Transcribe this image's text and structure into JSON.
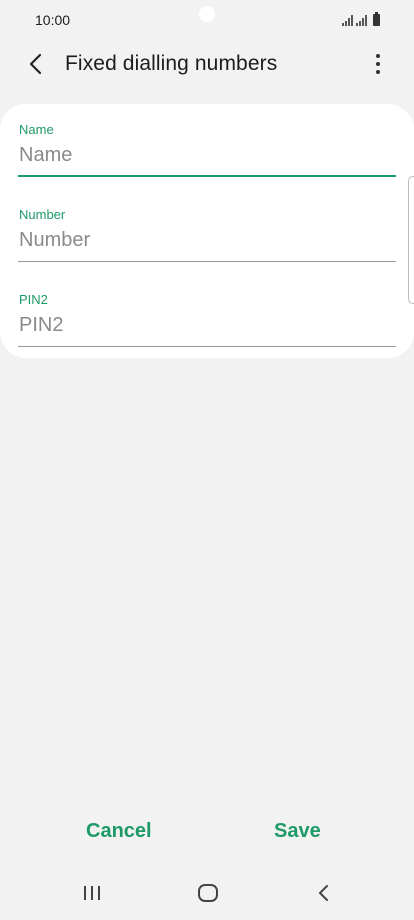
{
  "status_bar": {
    "time": "10:00"
  },
  "header": {
    "title": "Fixed dialling numbers",
    "back_icon": "chevron-left-icon",
    "more_icon": "more-vertical-icon"
  },
  "form": {
    "fields": [
      {
        "label": "Name",
        "placeholder": "Name",
        "value": "",
        "focused": true
      },
      {
        "label": "Number",
        "placeholder": "Number",
        "value": "",
        "focused": false
      },
      {
        "label": "PIN2",
        "placeholder": "PIN2",
        "value": "",
        "focused": false
      }
    ]
  },
  "actions": {
    "cancel_label": "Cancel",
    "save_label": "Save"
  },
  "colors": {
    "accent": "#1e9a68",
    "background": "#f2f2f2",
    "card": "#ffffff"
  }
}
